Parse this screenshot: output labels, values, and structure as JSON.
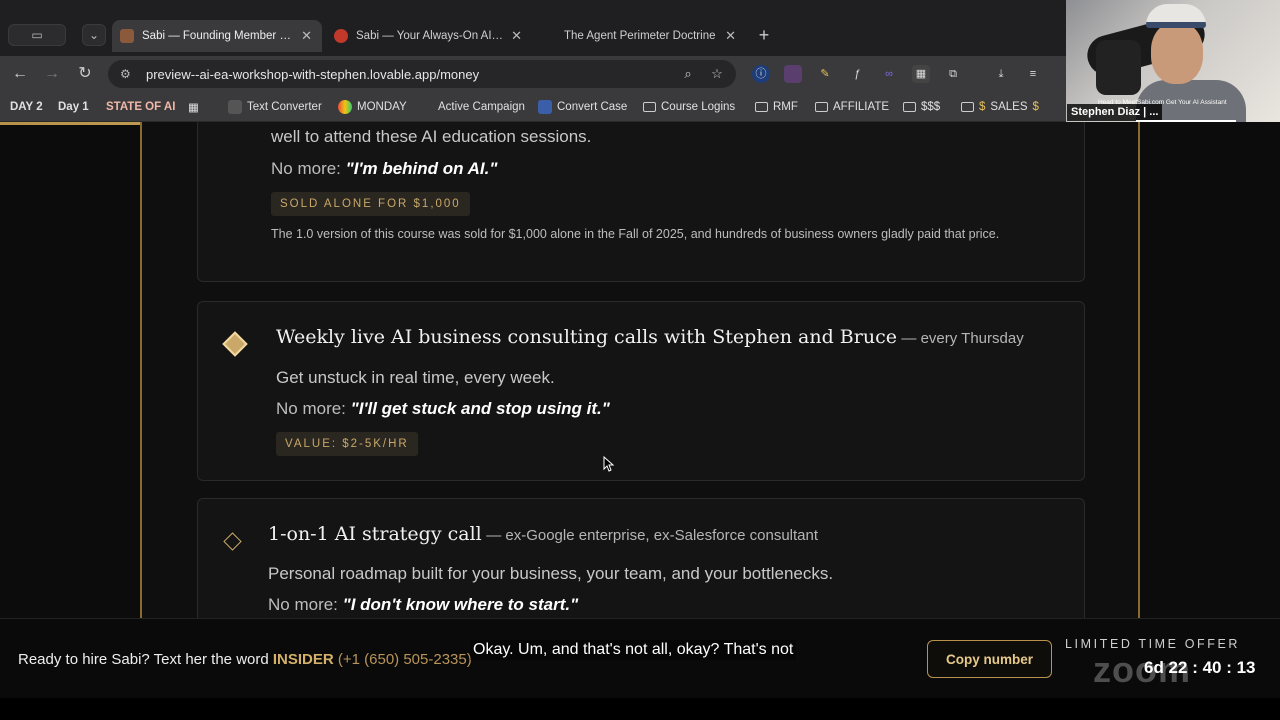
{
  "browser": {
    "tabs": [
      {
        "title": "Sabi — Founding Member Se",
        "active": true
      },
      {
        "title": "Sabi — Your Always-On AI As",
        "active": false
      },
      {
        "title": "The Agent Perimeter Doctrine",
        "active": false
      }
    ],
    "url": "preview--ai-ea-workshop-with-stephen.lovable.app/money",
    "bookmarks": [
      {
        "label": "DAY 2"
      },
      {
        "label": "Day 1"
      },
      {
        "label": "STATE OF AI"
      },
      {
        "label": "Text Converter"
      },
      {
        "label": "MONDAY"
      },
      {
        "label": "Active Campaign"
      },
      {
        "label": "Convert Case"
      },
      {
        "label": "Course Logins"
      },
      {
        "label": "RMF"
      },
      {
        "label": "AFFILIATE"
      },
      {
        "label": "$$$"
      },
      {
        "label": "SALES"
      }
    ]
  },
  "cards": [
    {
      "top_text": "well to attend these AI education sessions.",
      "no_more_label": "No more:",
      "no_more_quote": "\"I'm behind on AI.\"",
      "badge": "SOLD ALONE FOR $1,000",
      "note": "The 1.0 version of this course was sold for $1,000 alone in the Fall of 2025, and hundreds of business owners gladly paid that price."
    },
    {
      "title": "Weekly live AI business consulting calls with Stephen and Bruce",
      "subtitle": "— every Thursday",
      "desc": "Get unstuck in real time, every week.",
      "no_more_label": "No more:",
      "no_more_quote": "\"I'll get stuck and stop using it.\"",
      "badge": "VALUE: $2-5K/HR"
    },
    {
      "title": "1-on-1 AI strategy call",
      "subtitle": "— ex-Google enterprise, ex-Salesforce consultant",
      "desc": "Personal roadmap built for your business, your team, and your bottlenecks.",
      "no_more_label": "No more:",
      "no_more_quote": "\"I don't know where to start.\""
    }
  ],
  "bottom_bar": {
    "cta_prefix": "Ready to hire Sabi? Text her the word",
    "keyword": "INSIDER",
    "phone": "(+1 (650) 505-2335)",
    "copy_button": "Copy number",
    "offer_label": "LIMITED TIME OFFER",
    "countdown": "6d 22 : 40 : 13"
  },
  "caption": "Okay. Um, and that's not all, okay? That's not",
  "zoom_watermark": "zoom",
  "webcam": {
    "participant_name": "Stephen Diaz | ...",
    "banner_text": "Head to MeetSabi.com Get Your AI Assistant"
  },
  "colors": {
    "accent_gold": "#c9a86a",
    "column_border": "#8a6a2e",
    "background": "#0c0c0d"
  }
}
